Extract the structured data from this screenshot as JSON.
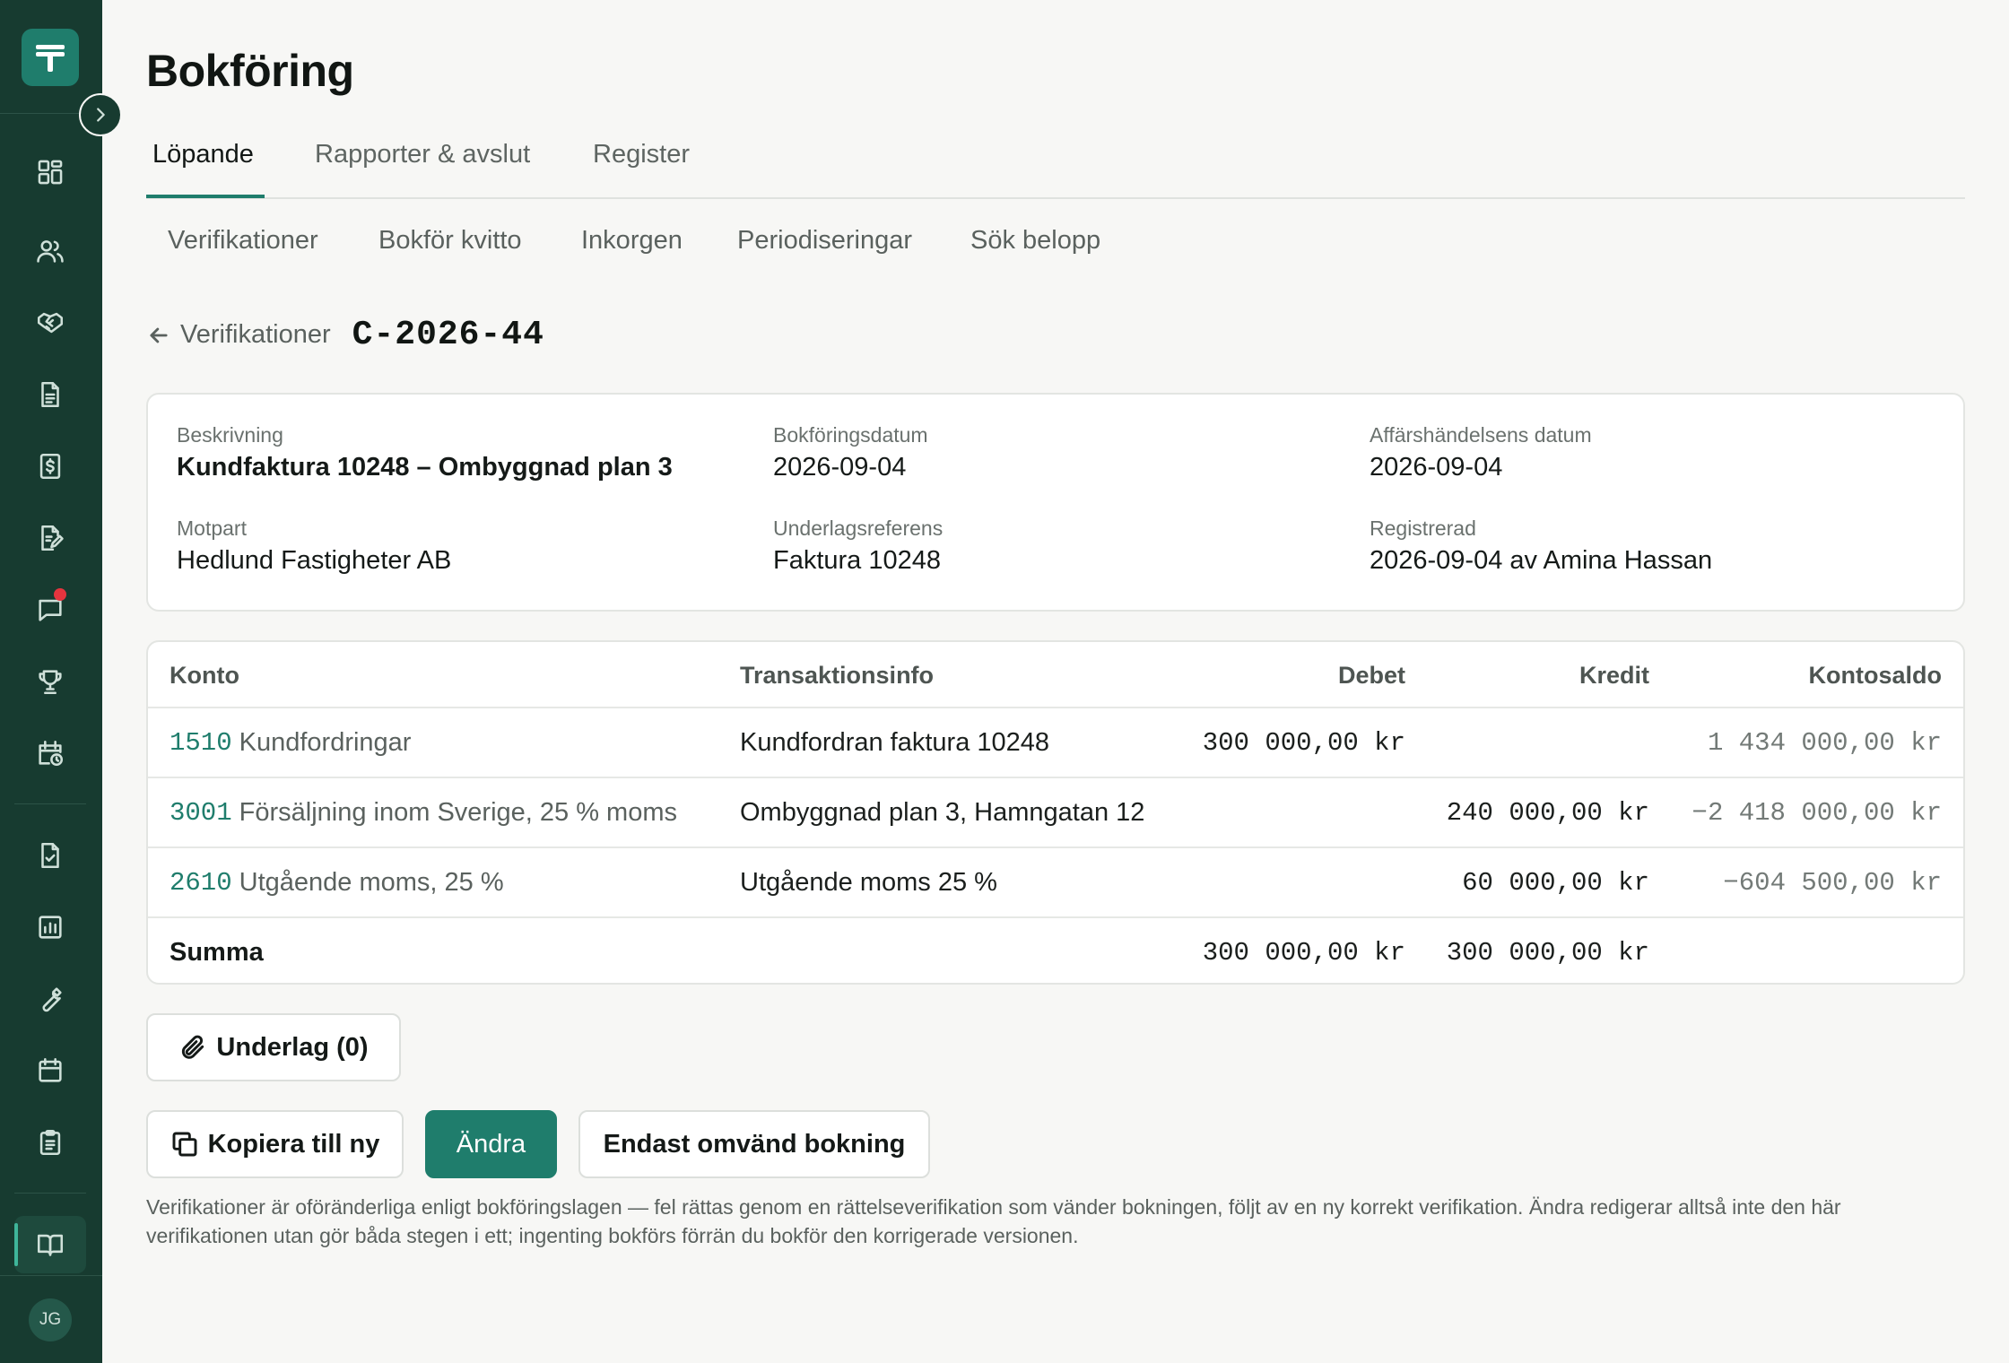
{
  "sidebar": {
    "items": [
      {
        "id": "overview",
        "icon": "dashboard-icon"
      },
      {
        "id": "customers",
        "icon": "users-icon"
      },
      {
        "id": "deals",
        "icon": "handshake-icon"
      },
      {
        "id": "documents",
        "icon": "document-icon"
      },
      {
        "id": "invoices",
        "icon": "invoice-dollar-icon"
      },
      {
        "id": "contracts",
        "icon": "document-edit-icon"
      },
      {
        "id": "messages",
        "icon": "chat-icon",
        "badge": true
      },
      {
        "id": "achievements",
        "icon": "trophy-icon"
      },
      {
        "id": "schedule",
        "icon": "calendar-clock-icon"
      },
      {
        "id": "approvals",
        "icon": "document-check-icon"
      },
      {
        "id": "reports",
        "icon": "chart-icon"
      },
      {
        "id": "tools",
        "icon": "wrench-icon"
      },
      {
        "id": "calendar",
        "icon": "calendar-icon"
      },
      {
        "id": "checklists",
        "icon": "clipboard-icon"
      },
      {
        "id": "bookkeeping",
        "icon": "book-open-icon",
        "active": true
      }
    ],
    "avatar_initials": "JG",
    "accent_color": "#1f7d6c",
    "sidebar_color": "#173b30"
  },
  "header": {
    "title": "Bokföring"
  },
  "tabs": [
    {
      "label": "Löpande",
      "active": true
    },
    {
      "label": "Rapporter & avslut"
    },
    {
      "label": "Register"
    }
  ],
  "subnav": [
    "Verifikationer",
    "Bokför kvitto",
    "Inkorgen",
    "Periodiseringar",
    "Sök belopp"
  ],
  "breadcrumb": {
    "back_label": "Verifikationer",
    "verification_id": "C-2026-44"
  },
  "details": {
    "description_label": "Beskrivning",
    "description": "Kundfaktura 10248 – Ombyggnad plan 3",
    "booking_date_label": "Bokföringsdatum",
    "booking_date": "2026-09-04",
    "transaction_date_label": "Affärshändelsens datum",
    "transaction_date": "2026-09-04",
    "counterparty_label": "Motpart",
    "counterparty": "Hedlund Fastigheter AB",
    "reference_label": "Underlagsreferens",
    "reference": "Faktura 10248",
    "registered_label": "Registrerad",
    "registered": "2026-09-04 av Amina Hassan"
  },
  "table": {
    "headers": {
      "account": "Konto",
      "info": "Transaktionsinfo",
      "debit": "Debet",
      "credit": "Kredit",
      "balance": "Kontosaldo"
    },
    "rows": [
      {
        "account_no": "1510",
        "account_name": "Kundfordringar",
        "info": "Kundfordran faktura 10248",
        "debit": "300 000,00 kr",
        "credit": "",
        "balance": "1 434 000,00 kr"
      },
      {
        "account_no": "3001",
        "account_name": "Försäljning inom Sverige, 25 % moms",
        "info": "Ombyggnad plan 3, Hamngatan 12",
        "debit": "",
        "credit": "240 000,00 kr",
        "balance": "−2 418 000,00 kr"
      },
      {
        "account_no": "2610",
        "account_name": "Utgående moms, 25 %",
        "info": "Utgående moms 25 %",
        "debit": "",
        "credit": "60 000,00 kr",
        "balance": "−604 500,00 kr"
      }
    ],
    "sum": {
      "label": "Summa",
      "debit": "300 000,00 kr",
      "credit": "300 000,00 kr"
    }
  },
  "attachments_button": "Underlag (0)",
  "actions": {
    "copy": "Kopiera till ny",
    "edit": "Ändra",
    "reverse": "Endast omvänd bokning"
  },
  "note": "Verifikationer är oföränderliga enligt bokföringslagen — fel rättas genom en rättelseverifikation som vänder bokningen, följt av en ny korrekt verifikation. Ändra redigerar alltså inte den här verifikationen utan gör båda stegen i ett; ingenting bokförs förrän du bokför den korrigerade versionen."
}
